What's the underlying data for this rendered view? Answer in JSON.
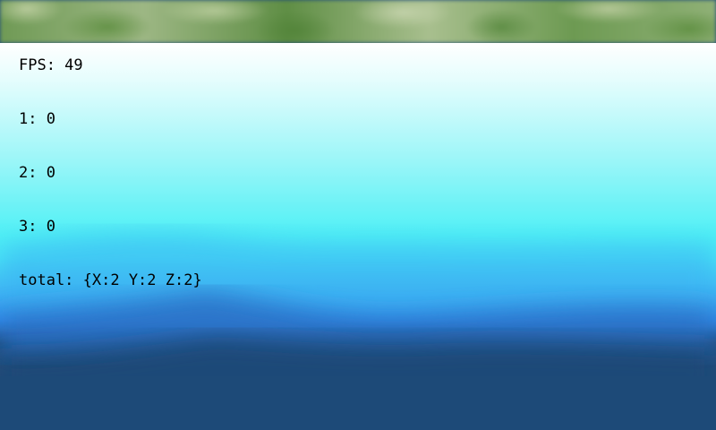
{
  "scene": {
    "colors": {
      "grass": "#7aa45e",
      "sky_top": "#ffffff",
      "cyan": "#4ff0f5",
      "blue": "#2f86ea",
      "deep_water": "#1d4a78"
    }
  },
  "hud": {
    "fps_label": "FPS: 49",
    "line_1": "1: 0",
    "line_2": "2: 0",
    "line_3": "3: 0",
    "total": "total: {X:2 Y:2 Z:2}"
  }
}
